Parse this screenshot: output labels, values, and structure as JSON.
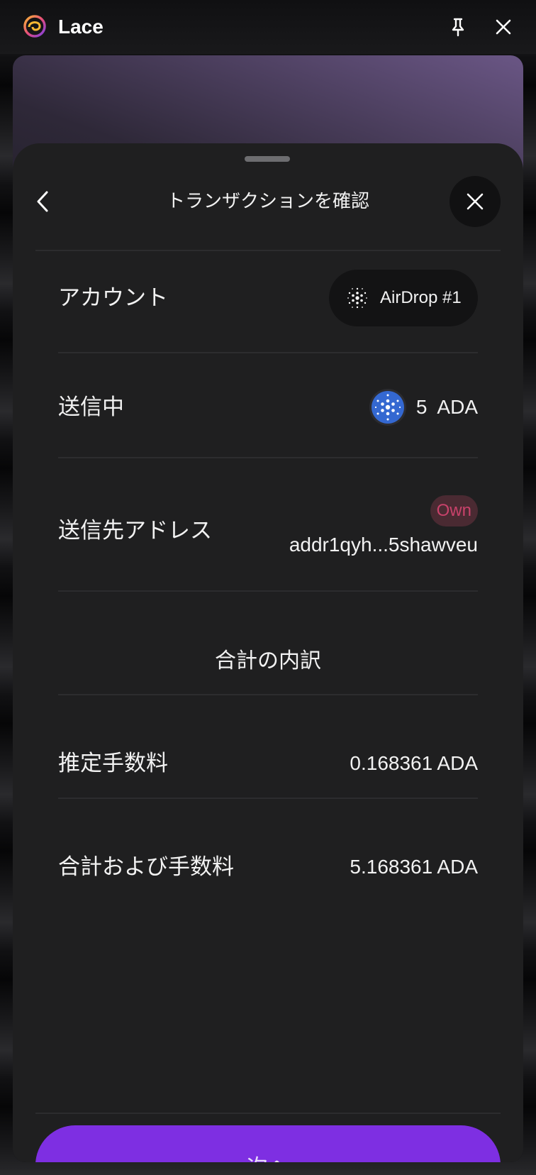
{
  "window": {
    "app_name": "Lace"
  },
  "sheet": {
    "title": "トランザクションを確認"
  },
  "account": {
    "label": "アカウント",
    "name": "AirDrop #1"
  },
  "sending": {
    "label": "送信中",
    "amount": "5",
    "unit": "ADA"
  },
  "recipient": {
    "label": "送信先アドレス",
    "badge": "Own",
    "address": "addr1qyh...5shawveu"
  },
  "breakdown": {
    "title": "合計の内訳"
  },
  "fee": {
    "label": "推定手数料",
    "value": "0.168361 ADA"
  },
  "total": {
    "label": "合計および手数料",
    "value": "5.168361 ADA"
  },
  "actions": {
    "next_label": "次へ"
  },
  "colors": {
    "accent": "#7e2fe2",
    "own_badge_text": "#c9426b",
    "ada_blue": "#3468d1"
  }
}
